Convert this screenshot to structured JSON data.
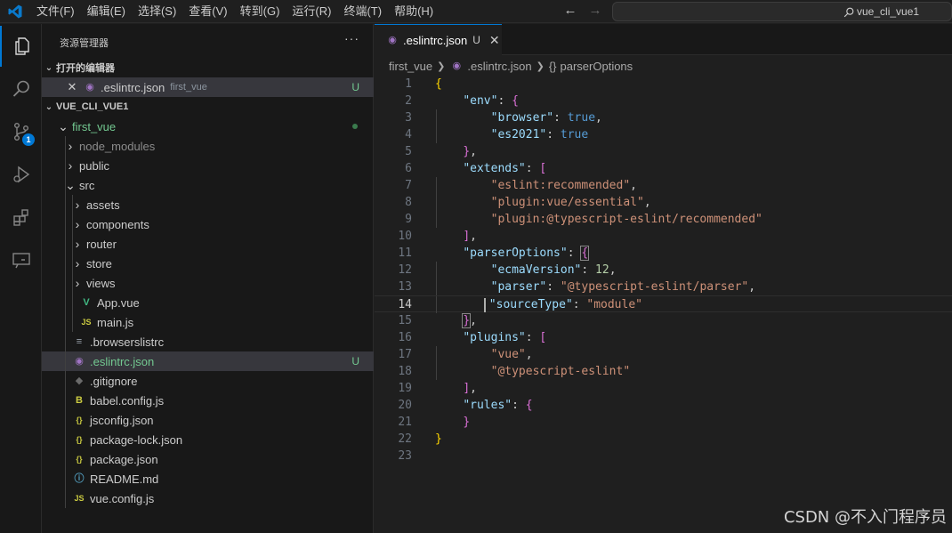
{
  "menubar": {
    "items": [
      "文件(F)",
      "编辑(E)",
      "选择(S)",
      "查看(V)",
      "转到(G)",
      "运行(R)",
      "终端(T)",
      "帮助(H)"
    ]
  },
  "command_center": {
    "text": "vue_cli_vue1",
    "icon": "search-icon"
  },
  "activity_bar": {
    "items": [
      {
        "name": "explorer",
        "icon": "files-icon",
        "active": true
      },
      {
        "name": "search",
        "icon": "search-icon"
      },
      {
        "name": "source-control",
        "icon": "source-control-icon",
        "badge": "1"
      },
      {
        "name": "run-debug",
        "icon": "run-debug-icon"
      },
      {
        "name": "extensions",
        "icon": "extensions-icon"
      },
      {
        "name": "remote",
        "icon": "remote-explorer-icon"
      }
    ]
  },
  "sidebar": {
    "title": "资源管理器",
    "more": "···",
    "open_editors": {
      "header": "打开的编辑器",
      "items": [
        {
          "label": ".eslintrc.json",
          "desc": "first_vue",
          "status": "U"
        }
      ]
    },
    "workspace": {
      "header": "VUE_CLI_VUE1",
      "tree": [
        {
          "label": "first_vue",
          "type": "folder-open",
          "depth": 0
        },
        {
          "label": "node_modules",
          "type": "folder",
          "depth": 1,
          "dim": true
        },
        {
          "label": "public",
          "type": "folder",
          "depth": 1
        },
        {
          "label": "src",
          "type": "folder-open",
          "depth": 1
        },
        {
          "label": "assets",
          "type": "folder",
          "depth": 2
        },
        {
          "label": "components",
          "type": "folder",
          "depth": 2
        },
        {
          "label": "router",
          "type": "folder",
          "depth": 2
        },
        {
          "label": "store",
          "type": "folder",
          "depth": 2
        },
        {
          "label": "views",
          "type": "folder",
          "depth": 2
        },
        {
          "label": "App.vue",
          "type": "vue",
          "depth": 2
        },
        {
          "label": "main.js",
          "type": "js",
          "depth": 2
        },
        {
          "label": ".browserslistrc",
          "type": "lines",
          "depth": 1
        },
        {
          "label": ".eslintrc.json",
          "type": "eslint",
          "depth": 1,
          "status": "U",
          "selected": true
        },
        {
          "label": ".gitignore",
          "type": "git",
          "depth": 1
        },
        {
          "label": "babel.config.js",
          "type": "babel",
          "depth": 1
        },
        {
          "label": "jsconfig.json",
          "type": "json",
          "depth": 1
        },
        {
          "label": "package-lock.json",
          "type": "json",
          "depth": 1
        },
        {
          "label": "package.json",
          "type": "json",
          "depth": 1
        },
        {
          "label": "README.md",
          "type": "info",
          "depth": 1
        },
        {
          "label": "vue.config.js",
          "type": "js",
          "depth": 1
        }
      ]
    }
  },
  "editor": {
    "tab": {
      "label": ".eslintrc.json",
      "status": "U"
    },
    "breadcrumbs": [
      "first_vue",
      ".eslintrc.json",
      "parserOptions"
    ],
    "current_line": 14,
    "lines": [
      "{",
      "    \"env\": {",
      "        \"browser\": true,",
      "        \"es2021\": true",
      "    },",
      "    \"extends\": [",
      "        \"eslint:recommended\",",
      "        \"plugin:vue/essential\",",
      "        \"plugin:@typescript-eslint/recommended\"",
      "    ],",
      "    \"parserOptions\": {",
      "        \"ecmaVersion\": 12,",
      "        \"parser\": \"@typescript-eslint/parser\",",
      "        \"sourceType\": \"module\"",
      "    },",
      "    \"plugins\": [",
      "        \"vue\",",
      "        \"@typescript-eslint\"",
      "    ],",
      "    \"rules\": {",
      "    }",
      "}",
      ""
    ]
  },
  "watermark": "CSDN @不入门程序员",
  "colors": {
    "accent": "#0078d4",
    "untracked": "#73c991",
    "vue": "#41b883",
    "js": "#cbcb41",
    "json": "#cbcb41",
    "eslint": "#a074c4"
  }
}
